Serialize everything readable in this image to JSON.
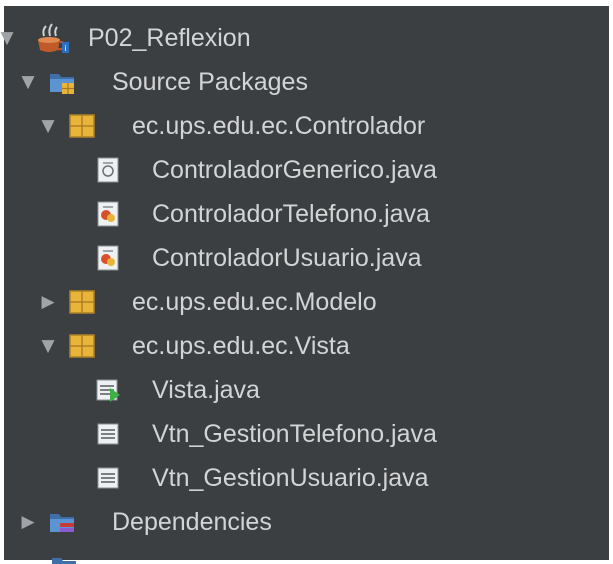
{
  "project": {
    "name": "P02_Reflexion",
    "icon": "java-project-coffee-cup-icon"
  },
  "source_packages": {
    "label": "Source Packages",
    "icon": "source-packages-folder-icon",
    "packages": [
      {
        "name": "ec.ups.edu.ec.Controlador",
        "expanded": true,
        "files": [
          "ControladorGenerico.java",
          "ControladorTelefono.java",
          "ControladorUsuario.java"
        ],
        "file_icons": [
          "java-class-icon",
          "java-class-icon",
          "java-class-icon"
        ]
      },
      {
        "name": "ec.ups.edu.ec.Modelo",
        "expanded": false,
        "files": []
      },
      {
        "name": "ec.ups.edu.ec.Vista",
        "expanded": true,
        "files": [
          "Vista.java",
          "Vtn_GestionTelefono.java",
          "Vtn_GestionUsuario.java"
        ],
        "file_icons": [
          "java-main-class-icon",
          "java-form-icon",
          "java-form-icon"
        ]
      }
    ]
  },
  "dependencies": {
    "label": "Dependencies",
    "icon": "dependencies-folder-icon"
  },
  "colors": {
    "background": "#3c3f41",
    "text": "#d2d4d6",
    "package_icon": "#e8b43a",
    "folder_icon": "#4a88c7"
  }
}
